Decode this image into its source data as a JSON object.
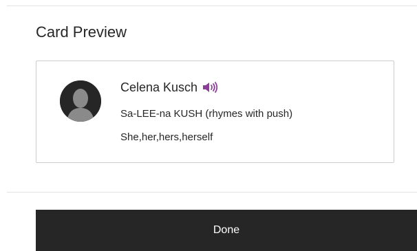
{
  "section": {
    "title": "Card Preview"
  },
  "card": {
    "name": "Celena Kusch",
    "pronunciation": "Sa-LEE-na KUSH (rhymes with push)",
    "pronouns": "She,her,hers,herself",
    "avatar_icon": "default-user-silhouette-icon",
    "audio_icon": "speaker-sound-icon"
  },
  "footer": {
    "done_label": "Done"
  },
  "colors": {
    "accent_purple": "#8c3f99",
    "button_background": "#262626",
    "card_border": "#cdcdcd",
    "divider": "#e2e2e2",
    "avatar_silhouette": "#8a8a8a"
  }
}
